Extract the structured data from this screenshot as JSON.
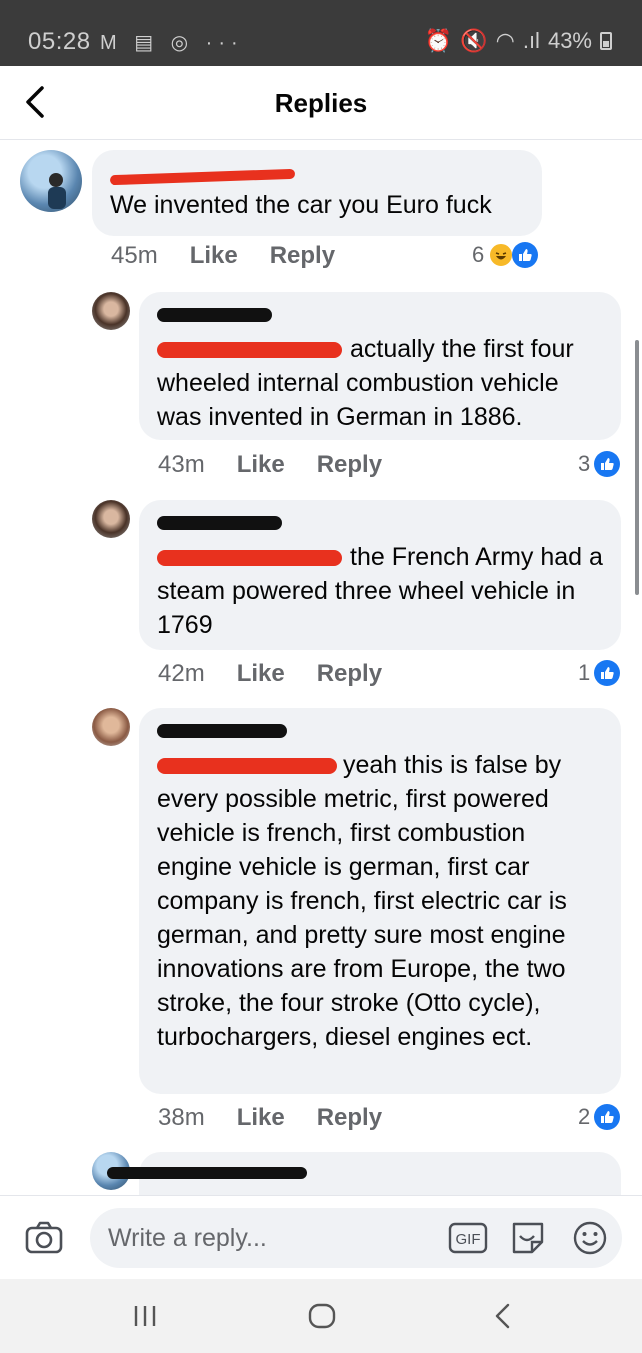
{
  "status_bar": {
    "time": "05:28",
    "battery": "43%"
  },
  "header": {
    "title": "Replies"
  },
  "comments": [
    {
      "text": "We invented the car you Euro fuck",
      "time": "45m",
      "like_label": "Like",
      "reply_label": "Reply",
      "reaction_count": "6"
    },
    {
      "text": "actually the first four wheeled internal combustion vehicle was invented in German in 1886.",
      "time": "43m",
      "like_label": "Like",
      "reply_label": "Reply",
      "reaction_count": "3"
    },
    {
      "text": "the French Army had a steam powered three wheel vehicle in 1769",
      "time": "42m",
      "like_label": "Like",
      "reply_label": "Reply",
      "reaction_count": "1"
    },
    {
      "text": "yeah this is false by every possible metric, first powered vehicle is french, first combustion engine vehicle is german, first car company is french, first electric car is german, and pretty sure most engine innovations are from Europe, the two stroke, the four stroke (Otto cycle), turbochargers, diesel engines ect.",
      "time": "38m",
      "like_label": "Like",
      "reply_label": "Reply",
      "reaction_count": "2"
    }
  ],
  "composer": {
    "placeholder": "Write a reply...",
    "gif_label": "GIF"
  },
  "colors": {
    "like_blue": "#1877f2",
    "bubble_bg": "#f0f2f5",
    "redaction_red": "#e8311e"
  }
}
